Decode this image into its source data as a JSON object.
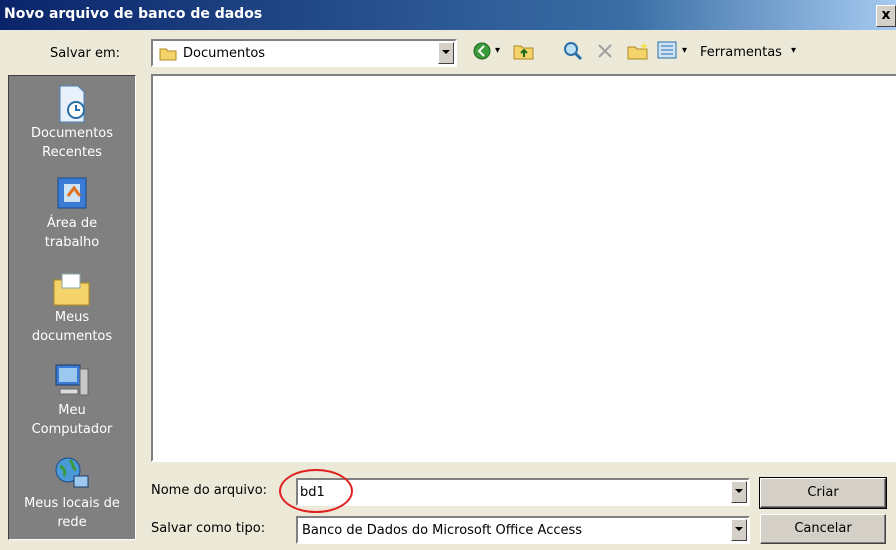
{
  "window": {
    "title": "Novo arquivo de banco de dados",
    "close_label": "x"
  },
  "location": {
    "label": "Salvar em:",
    "value": "Documentos"
  },
  "toolbar": {
    "tools_label": "Ferramentas"
  },
  "places": [
    {
      "line1": "Documentos",
      "line2": "Recentes"
    },
    {
      "line1": "Área de",
      "line2": "trabalho"
    },
    {
      "line1": "Meus",
      "line2": "documentos"
    },
    {
      "line1": "Meu",
      "line2": "Computador"
    },
    {
      "line1": "Meus locais de",
      "line2": "rede"
    }
  ],
  "filename": {
    "label": "Nome do arquivo:",
    "value": "bd1"
  },
  "filetype": {
    "label": "Salvar como tipo:",
    "value": "Banco de Dados do Microsoft Office Access"
  },
  "buttons": {
    "create": "Criar",
    "cancel": "Cancelar"
  },
  "colors": {
    "title_bar": "#0a246a",
    "annotation": "#e02020",
    "dialog_bg": "#ece9d8"
  }
}
